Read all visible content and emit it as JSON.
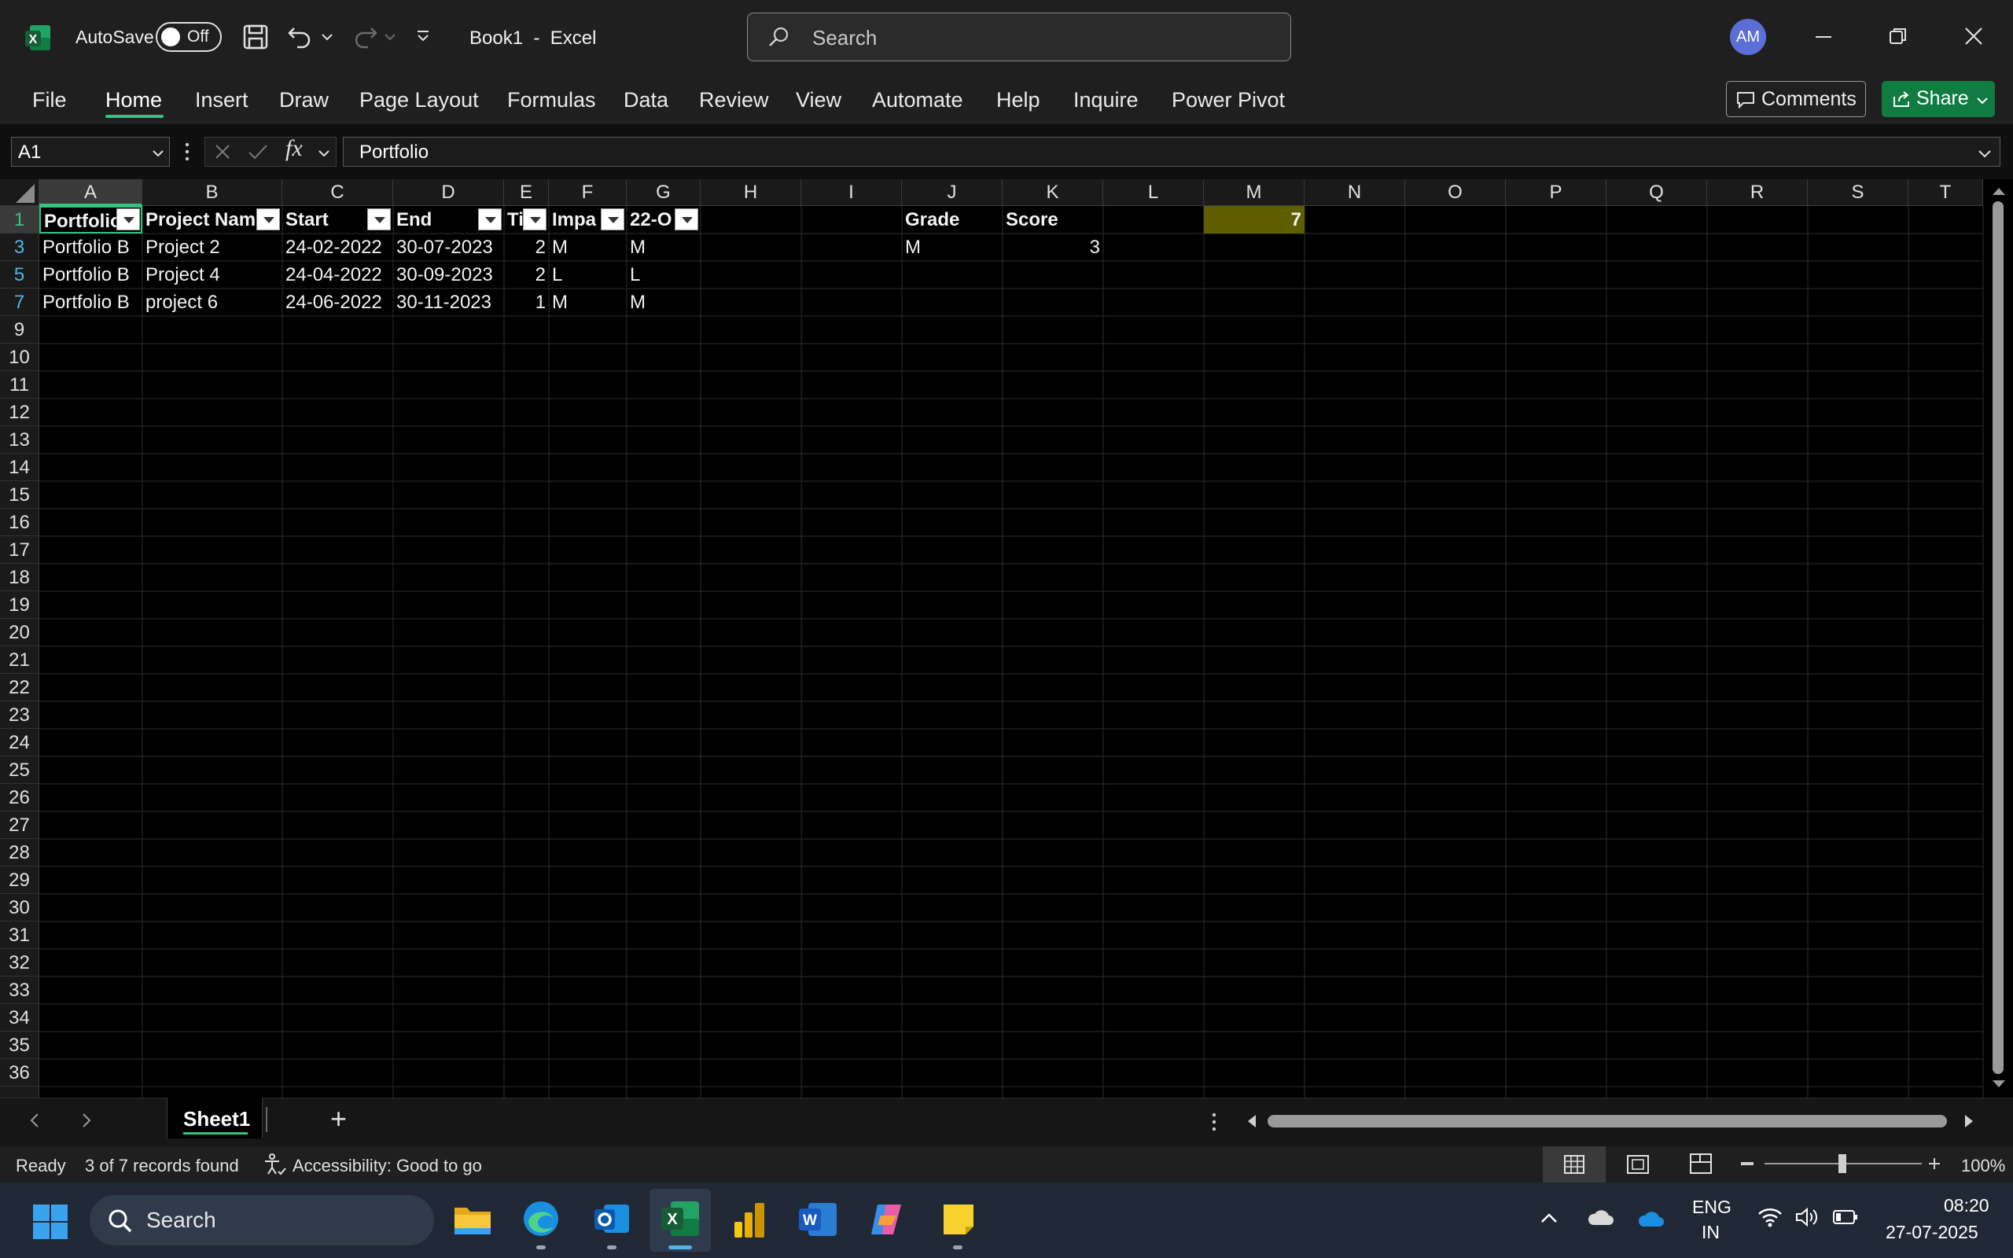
{
  "title_bar": {
    "autosave_label": "AutoSave",
    "autosave_state": "Off",
    "doc_title": "Book1  -  Excel",
    "search_placeholder": "Search",
    "avatar_initials": "AM"
  },
  "ribbon": {
    "tabs": [
      "File",
      "Home",
      "Insert",
      "Draw",
      "Page Layout",
      "Formulas",
      "Data",
      "Review",
      "View",
      "Automate",
      "Help",
      "Inquire",
      "Power Pivot"
    ],
    "active_tab": "Home",
    "comments_label": "Comments",
    "share_label": "Share"
  },
  "formula_bar": {
    "name_box": "A1",
    "fx": "fx",
    "content": "Portfolio"
  },
  "grid": {
    "columns": [
      "A",
      "B",
      "C",
      "D",
      "E",
      "F",
      "G",
      "H",
      "I",
      "J",
      "K",
      "L",
      "M",
      "N",
      "O",
      "P",
      "Q",
      "R",
      "S",
      "T"
    ],
    "row_numbers": [
      "1",
      "3",
      "5",
      "7",
      "9",
      "10",
      "11",
      "12",
      "13",
      "14",
      "15",
      "16",
      "17",
      "18",
      "19",
      "20",
      "21",
      "22",
      "23",
      "24",
      "25",
      "26",
      "27",
      "28",
      "29",
      "30",
      "31",
      "32",
      "33",
      "34",
      "35",
      "36"
    ],
    "header_row": [
      "Portfolio",
      "Project Nam",
      "Start",
      "End",
      "Ti",
      "Impa",
      "22-O"
    ],
    "data_rows": [
      [
        "Portfolio B",
        "Project 2",
        "24-02-2022",
        "30-07-2023",
        "2",
        "M",
        "M"
      ],
      [
        "Portfolio B",
        "Project 4",
        "24-04-2022",
        "30-09-2023",
        "2",
        "L",
        "L"
      ],
      [
        "Portfolio B",
        "project 6",
        "24-06-2022",
        "30-11-2023",
        "1",
        "M",
        "M"
      ]
    ],
    "side_table": {
      "grade_header": "Grade",
      "score_header": "Score",
      "grade_value": "M",
      "score_value": "3",
      "m1_value": "7"
    }
  },
  "sheets": {
    "tabs": [
      "Sheet1"
    ],
    "active": "Sheet1",
    "add_label": "+"
  },
  "status_bar": {
    "ready": "Ready",
    "records": "3 of 7 records found",
    "accessibility": "Accessibility: Good to go",
    "zoom": "100%",
    "zoom_level": 1.0
  },
  "taskbar": {
    "search_placeholder": "Search",
    "language_top": "ENG",
    "language_bottom": "IN",
    "time": "08:20",
    "date": "27-07-2025"
  },
  "colors": {
    "accent_green": "#33c481",
    "share_green": "#107c41",
    "m1_fill": "#5e5e00"
  }
}
